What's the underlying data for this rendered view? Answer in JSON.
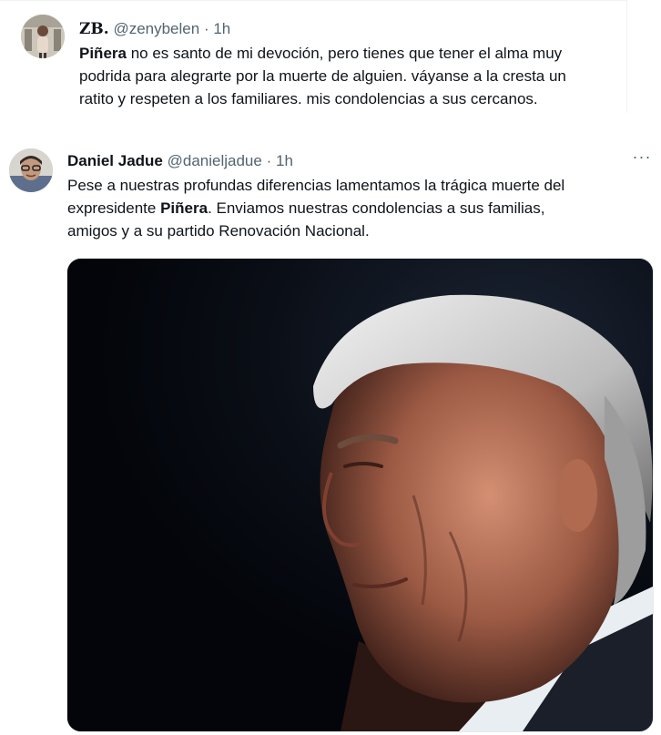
{
  "tweets": [
    {
      "name": "ZB.",
      "handle": "@zenybelen",
      "separator": "·",
      "time": "1h",
      "text_bold": "Piñera",
      "text_line1_rest": " no es santo de mi devoción, pero tienes que tener el alma muy",
      "text_line2": "podrida para alegrarte por la muerte de alguien. váyanse a la cresta un",
      "text_line3": "ratito y respeten a los familiares. mis condolencias a sus cercanos."
    },
    {
      "name": "Daniel Jadue",
      "handle": "@danieljadue",
      "separator": "·",
      "time": "1h",
      "more_label": "···",
      "text_line1": "Pese a nuestras profundas diferencias lamentamos la trágica muerte del",
      "text_line2_pre": "expresidente ",
      "text_bold": "Piñera",
      "text_line2_rest": ". Enviamos nuestras condolencias a sus familias,",
      "text_line3": "amigos y a su partido Renovación Nacional."
    }
  ]
}
